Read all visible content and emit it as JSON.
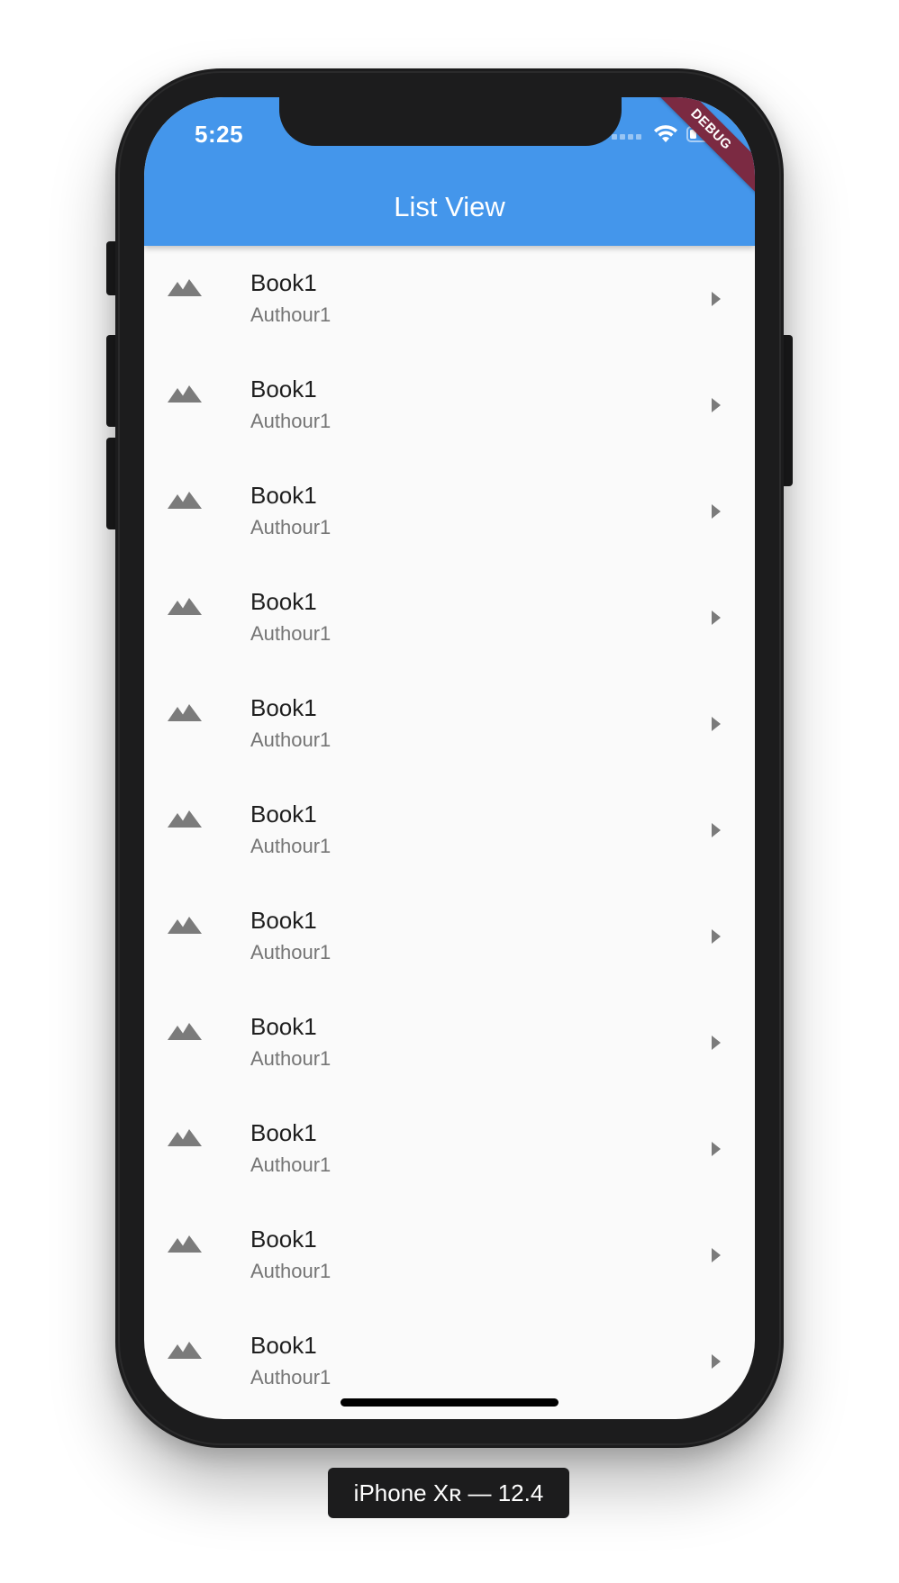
{
  "status_bar": {
    "time": "5:25",
    "signal_icon": "signal-dots-icon",
    "wifi_icon": "wifi-icon",
    "battery_icon": "battery-icon"
  },
  "debug_banner": "DEBUG",
  "app_bar": {
    "title": "List View",
    "color": "#4496eb"
  },
  "list": {
    "items": [
      {
        "title": "Book1",
        "subtitle": "Authour1",
        "leading_icon": "landscape-icon",
        "trailing_icon": "arrow-right-icon"
      },
      {
        "title": "Book1",
        "subtitle": "Authour1",
        "leading_icon": "landscape-icon",
        "trailing_icon": "arrow-right-icon"
      },
      {
        "title": "Book1",
        "subtitle": "Authour1",
        "leading_icon": "landscape-icon",
        "trailing_icon": "arrow-right-icon"
      },
      {
        "title": "Book1",
        "subtitle": "Authour1",
        "leading_icon": "landscape-icon",
        "trailing_icon": "arrow-right-icon"
      },
      {
        "title": "Book1",
        "subtitle": "Authour1",
        "leading_icon": "landscape-icon",
        "trailing_icon": "arrow-right-icon"
      },
      {
        "title": "Book1",
        "subtitle": "Authour1",
        "leading_icon": "landscape-icon",
        "trailing_icon": "arrow-right-icon"
      },
      {
        "title": "Book1",
        "subtitle": "Authour1",
        "leading_icon": "landscape-icon",
        "trailing_icon": "arrow-right-icon"
      },
      {
        "title": "Book1",
        "subtitle": "Authour1",
        "leading_icon": "landscape-icon",
        "trailing_icon": "arrow-right-icon"
      },
      {
        "title": "Book1",
        "subtitle": "Authour1",
        "leading_icon": "landscape-icon",
        "trailing_icon": "arrow-right-icon"
      },
      {
        "title": "Book1",
        "subtitle": "Authour1",
        "leading_icon": "landscape-icon",
        "trailing_icon": "arrow-right-icon"
      },
      {
        "title": "Book1",
        "subtitle": "Authour1",
        "leading_icon": "landscape-icon",
        "trailing_icon": "arrow-right-icon"
      }
    ]
  },
  "device_label": "iPhone Xʀ — 12.4"
}
